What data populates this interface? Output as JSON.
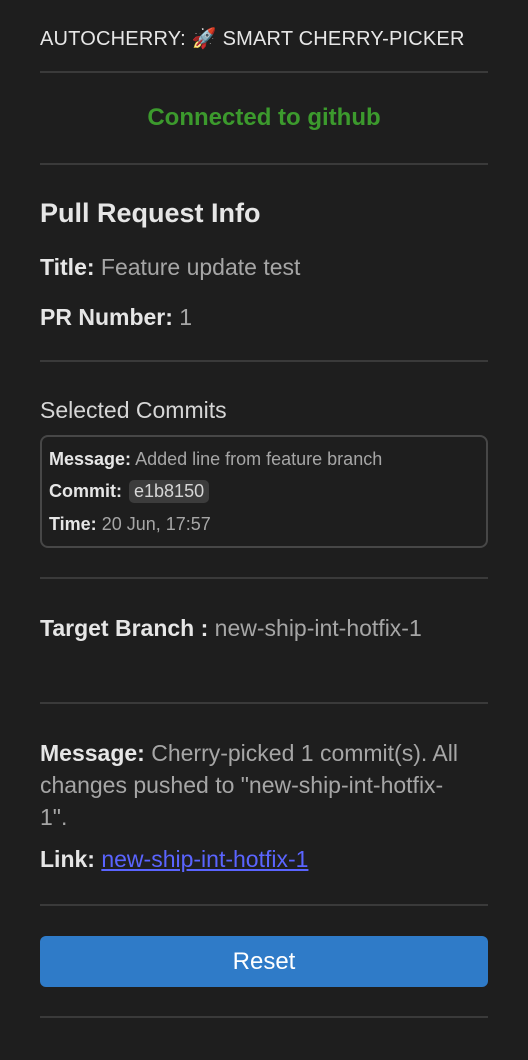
{
  "header": {
    "title_prefix": "AUTOCHERRY:",
    "icon": "rocket-icon",
    "icon_glyph": "🚀",
    "title_suffix": "SMART CHERRY-PICKER"
  },
  "status": {
    "text": "Connected to github",
    "color": "#3c9a2d"
  },
  "pr_info": {
    "heading": "Pull Request Info",
    "title_label": "Title:",
    "title_value": "Feature update test",
    "number_label": "PR Number:",
    "number_value": "1"
  },
  "selected_commits": {
    "heading": "Selected Commits",
    "items": [
      {
        "message_label": "Message:",
        "message": "Added line from feature branch",
        "commit_label": "Commit:",
        "hash": "e1b8150",
        "time_label": "Time:",
        "time": "20 Jun, 17:57"
      }
    ]
  },
  "target_branch": {
    "label": "Target Branch :",
    "value": "new-ship-int-hotfix-1"
  },
  "result": {
    "message_label": "Message:",
    "message": "Cherry-picked 1 commit(s). All changes pushed to \"new-ship-int-hotfix-1\".",
    "link_label": "Link:",
    "link_text": "new-ship-int-hotfix-1"
  },
  "actions": {
    "reset_label": "Reset",
    "reset_color": "#2f7bc8"
  }
}
